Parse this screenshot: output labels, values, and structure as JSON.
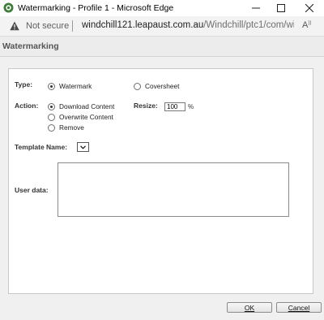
{
  "window": {
    "title": "Watermarking - Profile 1 - Microsoft Edge"
  },
  "addressbar": {
    "security_label": "Not secure",
    "url_host": "windchill121.leapaust.com.au",
    "url_path": "/Windchill/ptc1/com/winc..."
  },
  "dialog": {
    "header_title": "Watermarking",
    "type_label": "Type:",
    "type_options": [
      {
        "label": "Watermark",
        "checked": true
      },
      {
        "label": "Coversheet",
        "checked": false
      }
    ],
    "action_label": "Action:",
    "action_options": [
      {
        "label": "Download Content",
        "checked": true
      },
      {
        "label": "Overwrite Content",
        "checked": false
      },
      {
        "label": "Remove",
        "checked": false
      }
    ],
    "resize_label": "Resize:",
    "resize_value": "100",
    "resize_unit": "%",
    "template_label": "Template Name:",
    "template_value": "",
    "userdata_label": "User data:",
    "userdata_value": "",
    "ok_label": "OK",
    "cancel_label": "Cancel"
  }
}
